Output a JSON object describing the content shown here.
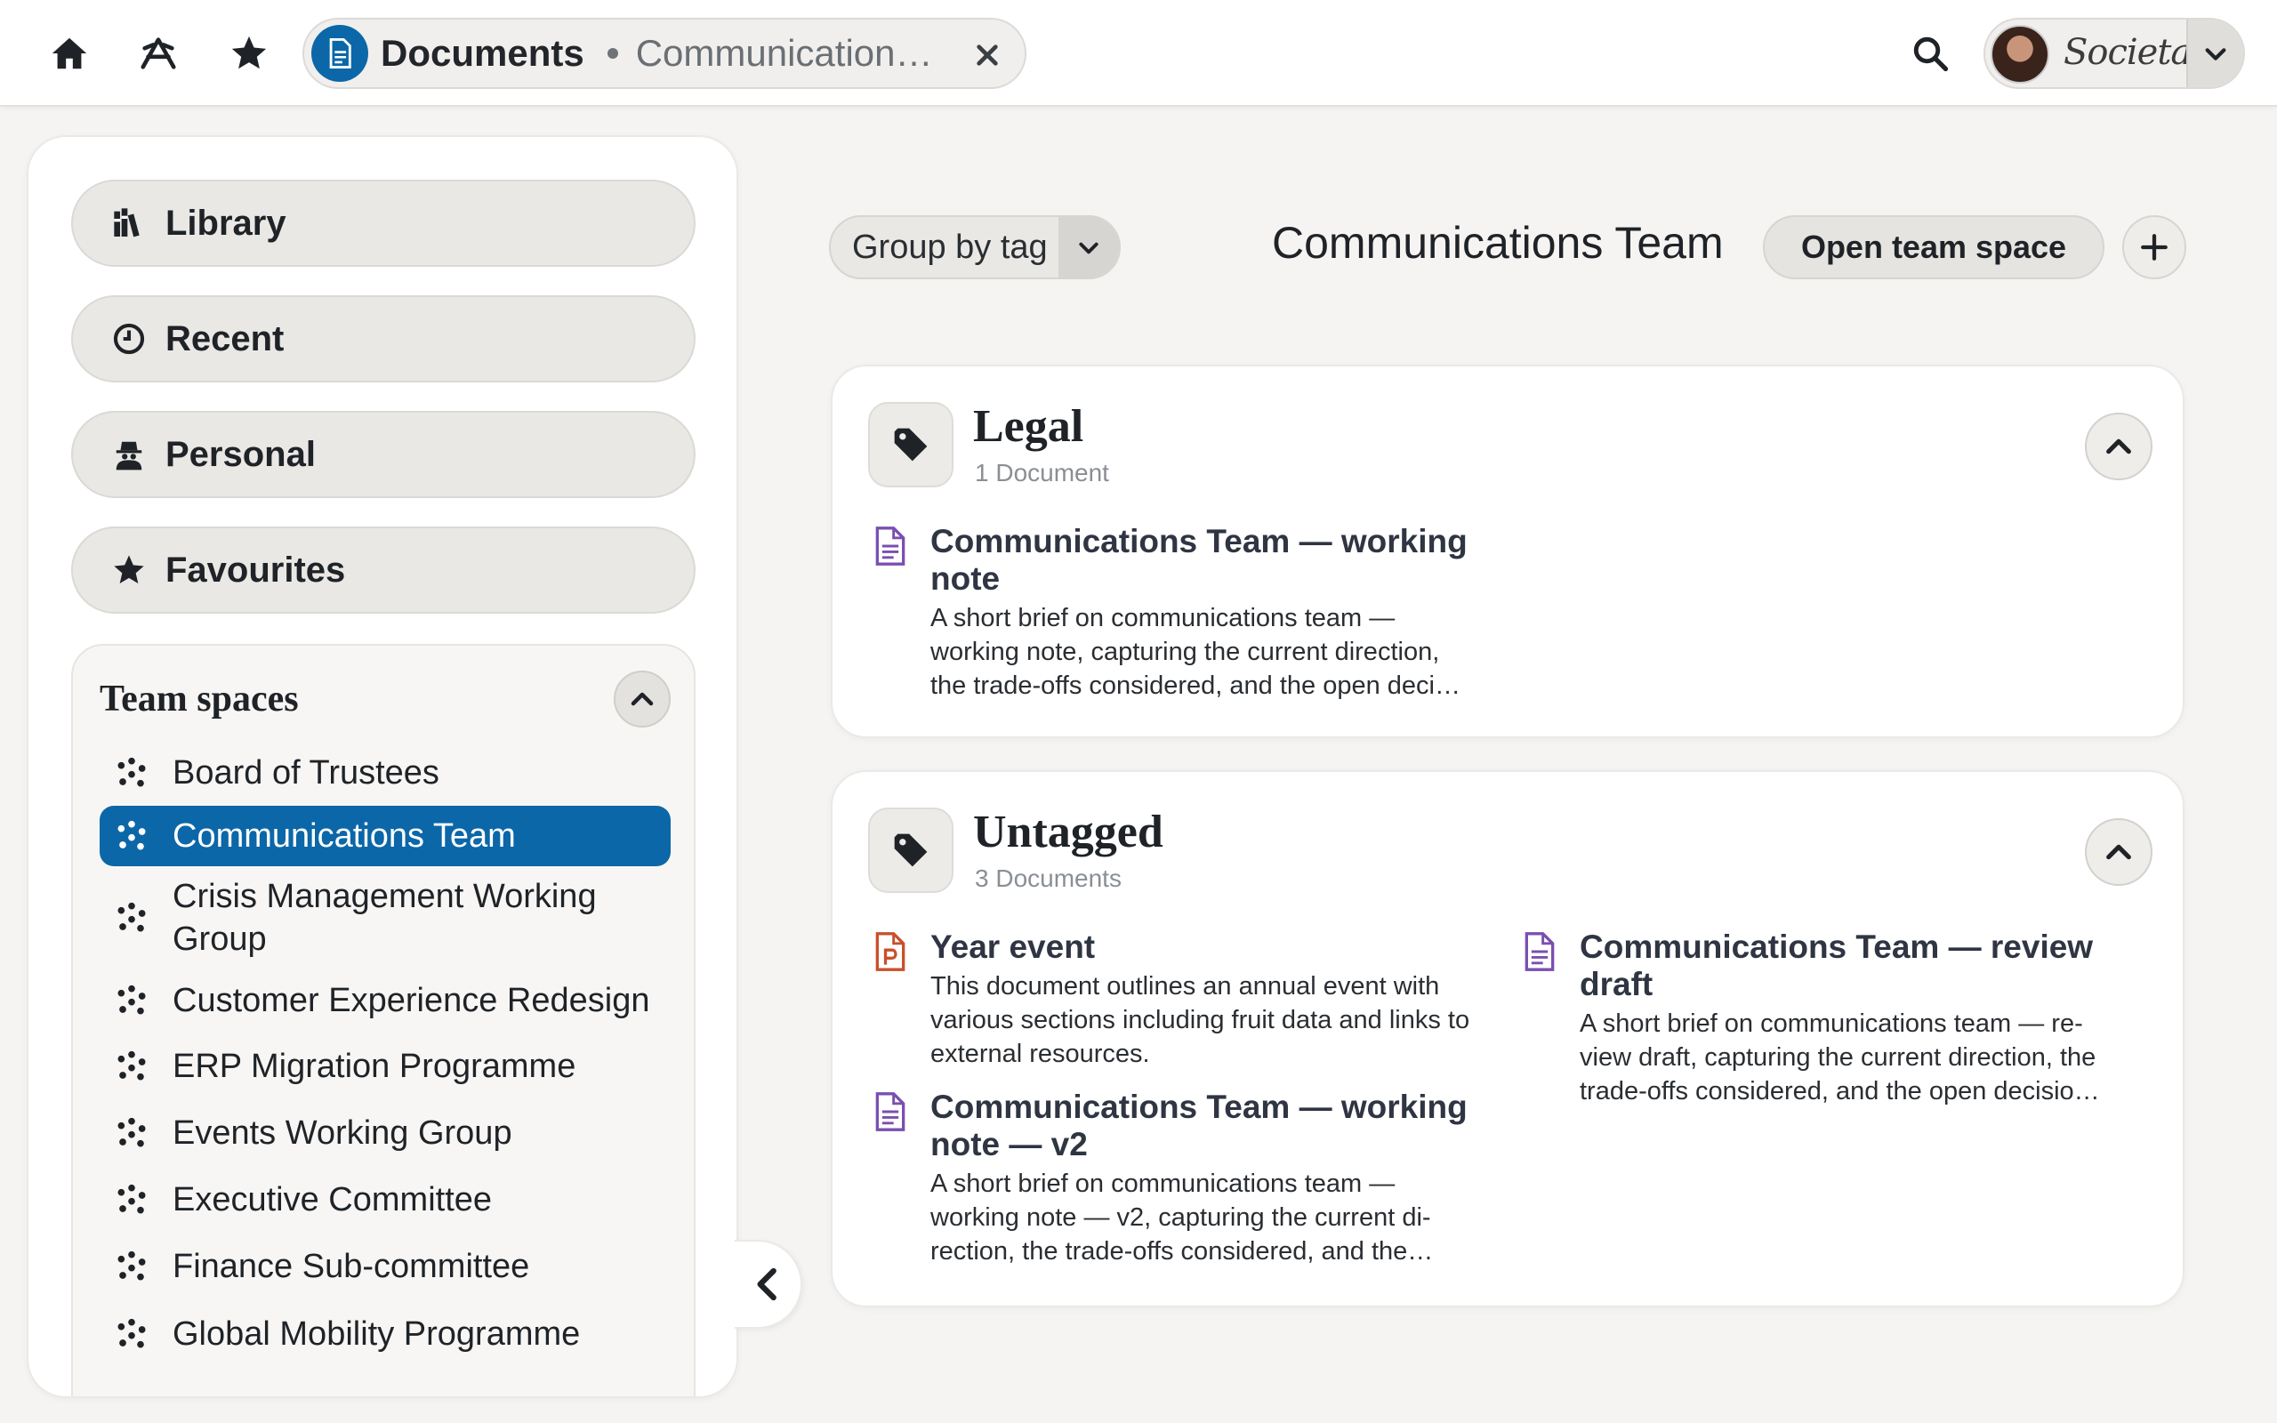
{
  "topbar": {
    "icons": {
      "home": "home-icon",
      "apps": "apps-icon",
      "star": "star-icon",
      "search": "search-icon"
    },
    "doc_chip": {
      "title": "Documents",
      "subtitle": "Communication…",
      "icon": "document-icon",
      "close_icon": "close-icon"
    },
    "user": {
      "logo_text": "Societas",
      "menu_icon": "chevron-down-icon"
    }
  },
  "sidebar": {
    "nav": [
      {
        "label": "Library",
        "icon": "books-icon"
      },
      {
        "label": "Recent",
        "icon": "clock-icon"
      },
      {
        "label": "Personal",
        "icon": "user-secret-icon"
      },
      {
        "label": "Favourites",
        "icon": "star-icon"
      }
    ],
    "team_spaces": {
      "heading": "Team spaces",
      "items": [
        {
          "label": "Board of Trustees"
        },
        {
          "label": "Communications Team",
          "active": true
        },
        {
          "label": "Crisis Management Working Group"
        },
        {
          "label": "Customer Experience Redesign"
        },
        {
          "label": "ERP Migration Programme"
        },
        {
          "label": "Events Working Group"
        },
        {
          "label": "Executive Committee"
        },
        {
          "label": "Finance Sub-committee"
        },
        {
          "label": "Global Mobility Programme"
        }
      ]
    }
  },
  "main": {
    "group_by": "Group by tag",
    "title": "Communications Team",
    "open_button": "Open team space",
    "groups": [
      {
        "title": "Legal",
        "count": "1 Document",
        "docs": [
          {
            "title": "Communications Team — working note",
            "description": "A short brief on communications team — working note, capturing the current direction, the trade-offs considered, and the open deci…",
            "type": "text-document",
            "color": "#7a4fb0"
          }
        ]
      },
      {
        "title": "Untagged",
        "count": "3 Documents",
        "docs": [
          {
            "title": "Year event",
            "description": "This document outlines an annual event with various sections including fruit data and links to external resources.",
            "type": "presentation",
            "color": "#c8502a"
          },
          {
            "title": "Communications Team — review draft",
            "description": "A short brief on communications team — re-view draft, capturing the current direction, the trade-offs considered, and the open decisio…",
            "type": "text-document",
            "color": "#7a4fb0"
          },
          {
            "title": "Communications Team — working note — v2",
            "description": "A short brief on communications team — working note — v2, capturing the current di-rection, the trade-offs considered, and the…",
            "type": "text-document",
            "color": "#7a4fb0"
          }
        ]
      }
    ]
  },
  "colors": {
    "accent": "#0b67a8",
    "text_doc": "#7a4fb0",
    "presentation": "#c8502a"
  }
}
